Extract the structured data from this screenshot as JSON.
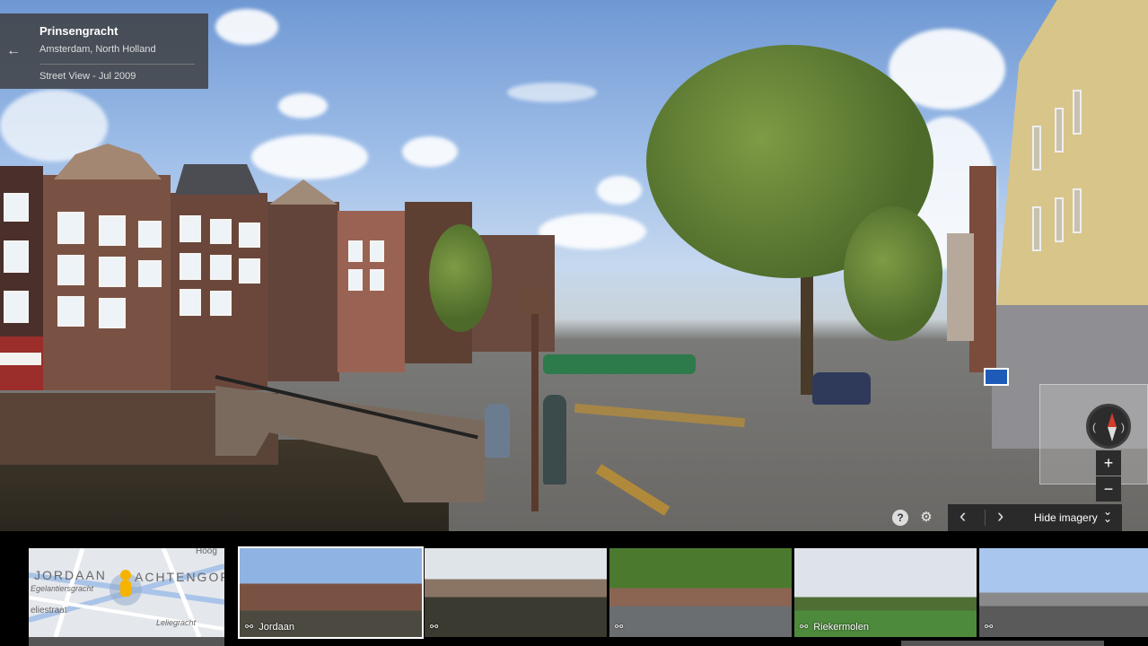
{
  "info_card": {
    "title": "Prinsengracht",
    "subtitle": "Amsterdam, North Holland",
    "date": "Street View - Jul 2009",
    "back_icon": "arrow-left-icon"
  },
  "controls": {
    "help_icon": "?",
    "settings_icon": "⚙",
    "zoom_in": "+",
    "zoom_out": "−",
    "prev_arrow": "‹",
    "next_arrow": "›",
    "hide_imagery_label": "Hide imagery"
  },
  "minimap": {
    "labels": [
      "JORDAAN",
      "ACHTENGORD",
      "Egelantiersgracht",
      "eliestraat",
      "Leliegracht",
      "Hoog"
    ]
  },
  "thumbnails": [
    {
      "label": "Jordaan",
      "icon": "street-view-icon",
      "active": true
    },
    {
      "label": "",
      "icon": "street-view-icon",
      "active": false
    },
    {
      "label": "",
      "icon": "street-view-icon",
      "active": false
    },
    {
      "label": "Riekermolen",
      "icon": "street-view-icon",
      "active": false
    },
    {
      "label": "",
      "icon": "street-view-icon",
      "active": false
    }
  ],
  "colors": {
    "sky": "#8fb3e3",
    "brick": "#6e4a3c",
    "tree": "#5d7a31",
    "yellow_building": "#d8c58a"
  }
}
